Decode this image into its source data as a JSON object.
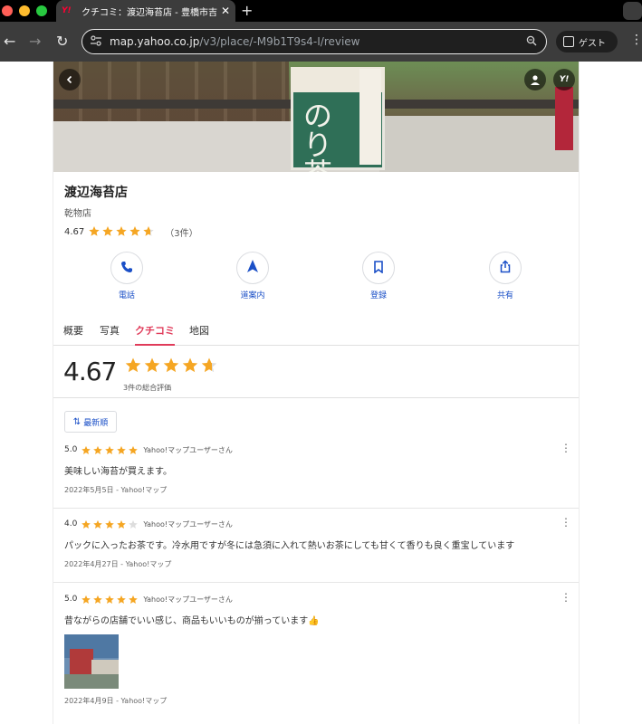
{
  "browser": {
    "tab_title": "クチコミ：渡辺海苔店 - 豊橋市吉",
    "tab_favicon": "Y!",
    "tab_close": "✕",
    "new_tab": "+",
    "url_host": "map.yahoo.co.jp",
    "url_path": "/v3/place/-M9b1T9s4-I/review",
    "guest_label": "ゲスト",
    "back_glyph": "←",
    "forward_glyph": "→",
    "reload_glyph": "↻"
  },
  "shop": {
    "name": "渡辺海苔店",
    "category": "乾物店",
    "rating": "4.67",
    "rating_fraction": 0.934,
    "review_count": "（3件）",
    "photo_sign_text": "のり茶"
  },
  "actions": [
    {
      "label": "電話",
      "icon": "phone-icon"
    },
    {
      "label": "道案内",
      "icon": "navigation-arrow-icon"
    },
    {
      "label": "登録",
      "icon": "bookmark-icon"
    },
    {
      "label": "共有",
      "icon": "share-icon"
    }
  ],
  "page_tabs": [
    {
      "label": "概要",
      "active": false
    },
    {
      "label": "写真",
      "active": false
    },
    {
      "label": "クチコミ",
      "active": true
    },
    {
      "label": "地図",
      "active": false
    }
  ],
  "summary": {
    "score": "4.67",
    "score_fraction": 0.934,
    "subtitle": "3件の総合評価"
  },
  "sort": {
    "label": "最新順",
    "icon": "⇅"
  },
  "reviews": [
    {
      "score": "5.0",
      "stars": 5,
      "user": "Yahoo!マップユーザーさん",
      "text": "美味しい海苔が買えます。",
      "date": "2022年5月5日 - Yahoo!マップ",
      "has_photo": false
    },
    {
      "score": "4.0",
      "stars": 4,
      "user": "Yahoo!マップユーザーさん",
      "text": "パックに入ったお茶です。冷水用ですが冬には急須に入れて熱いお茶にしても甘くて香りも良く重宝しています",
      "date": "2022年4月27日 - Yahoo!マップ",
      "has_photo": false
    },
    {
      "score": "5.0",
      "stars": 5,
      "user": "Yahoo!マップユーザーさん",
      "text": "昔ながらの店舗でいい感じ、商品もいいものが揃っています👍",
      "date": "2022年4月9日 - Yahoo!マップ",
      "has_photo": true
    }
  ],
  "colors": {
    "star": "#f5a623",
    "star_empty": "#dddddd",
    "accent_tab": "#e03b5a",
    "link_blue": "#1a4fc7"
  }
}
